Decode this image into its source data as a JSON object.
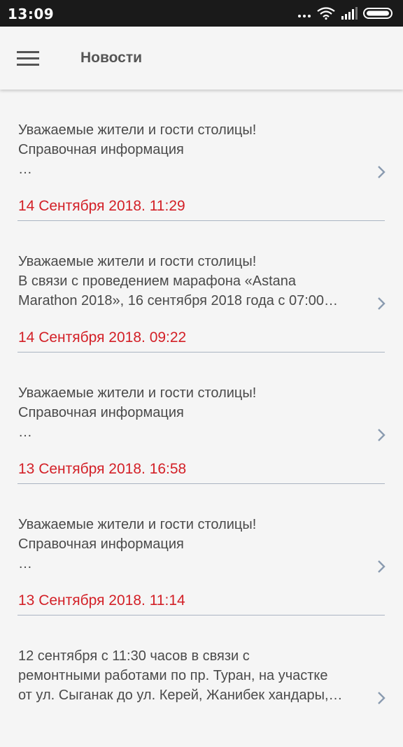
{
  "status_bar": {
    "time": "13:09"
  },
  "app_bar": {
    "title": "Новости"
  },
  "news": [
    {
      "lines": [
        "Уважаемые жители и гости столицы!",
        "Справочная информация",
        " …"
      ],
      "date": "14 Сентября 2018. 11:29"
    },
    {
      "lines": [
        "Уважаемые жители и гости столицы!",
        "В связи с проведением марафона «Astana",
        "Marathon 2018», 16 сентября 2018 года с 07:00…"
      ],
      "date": "14 Сентября 2018. 09:22"
    },
    {
      "lines": [
        "Уважаемые жители и гости столицы!",
        "Справочная информация",
        " …"
      ],
      "date": "13 Сентября 2018. 16:58"
    },
    {
      "lines": [
        "Уважаемые жители и гости столицы!",
        "Справочная информация",
        " …"
      ],
      "date": "13 Сентября 2018. 11:14"
    },
    {
      "lines": [
        "12 сентября с 11:30 часов в связи с",
        "ремонтными работами по пр. Туран, на участке",
        "от ул. Сыганак до ул. Керей, Жанибек хандары,…"
      ],
      "date": ""
    }
  ],
  "colors": {
    "date_red": "#d32027",
    "divider": "#aab4c2",
    "chevron": "#8a9bb0"
  }
}
